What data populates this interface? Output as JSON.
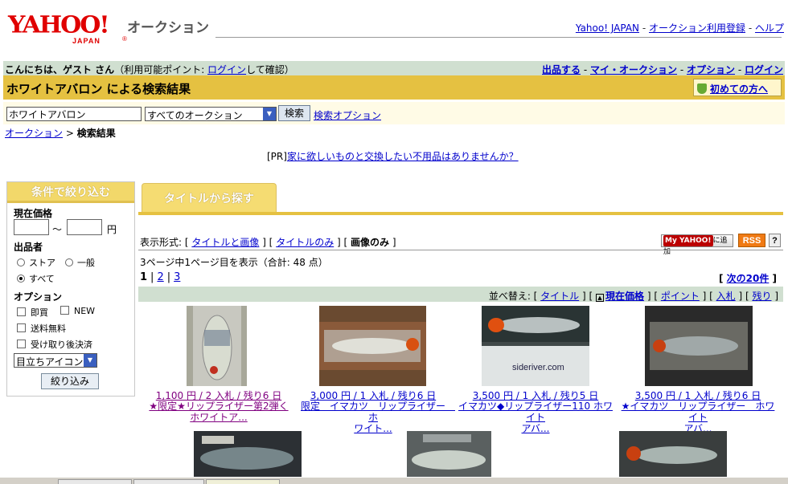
{
  "header": {
    "logo_text": "YAHOO!",
    "logo_sub": "JAPAN",
    "service": "オークション",
    "links": [
      "Yahoo! JAPAN",
      "オークション利用登録",
      "ヘルプ"
    ]
  },
  "greeting": {
    "hello": "こんにちは、ゲスト さん",
    "points_prefix": "（利用可能ポイント: ",
    "login": "ログイン",
    "points_suffix": "して確認）",
    "links": [
      "出品する",
      "マイ・オークション",
      "オプション",
      "ログイン"
    ]
  },
  "results": {
    "title": "ホワイトアバロン による検索結果",
    "first_time": "初めての方へ"
  },
  "search": {
    "query": "ホワイトアバロン",
    "category": "すべてのオークション",
    "button": "検索",
    "options_link": "検索オプション"
  },
  "breadcrumb": {
    "root": "オークション",
    "current": "検索結果"
  },
  "pr": {
    "prefix": "[PR]",
    "text": "家に欲しいものと交換したい不用品はありませんか？"
  },
  "filter": {
    "title": "条件で絞り込む",
    "price_label": "現在価格",
    "tilde": "～",
    "yen": "円",
    "seller_label": "出品者",
    "seller_options": [
      "ストア",
      "一般",
      "すべて"
    ],
    "option_label": "オプション",
    "options": [
      "即買",
      "NEW",
      "送料無料",
      "受け取り後決済"
    ],
    "icon_select": "目立ちアイコン",
    "button": "絞り込み"
  },
  "tab": {
    "label": "タイトルから探す"
  },
  "display": {
    "label": "表示形式:",
    "opt1": "タイトルと画像",
    "opt2": "タイトルのみ",
    "opt3": "画像のみ",
    "myyahoo": "に追加",
    "rss": "RSS",
    "help": "?"
  },
  "paging": {
    "summary": "3ページ中1ページ目を表示（合計: 48 点）",
    "pages": [
      "1",
      "2",
      "3"
    ],
    "next": "次の20件"
  },
  "sort": {
    "label": "並べ替え:",
    "options": [
      "タイトル",
      "現在価格",
      "ポイント",
      "入札",
      "残り"
    ]
  },
  "items": [
    {
      "price": "1,100 円 / 2 入札 / 残り6 日",
      "title1": "★限定★リップライザー第2弾く",
      "title2": "ホワイトア..."
    },
    {
      "price": "3,000 円 / 1 入札 / 残り6 日",
      "title1": "限定　イマカツ　リップライザー　ホ",
      "title2": "ワイト..."
    },
    {
      "price": "3,500 円 / 1 入札 / 残り5 日",
      "title1": "イマカツ◆リップライザー110 ホワイト",
      "title2": "アバ..."
    },
    {
      "price": "3,500 円 / 1 入札 / 残り6 日",
      "title1": "★イマカツ　リップライザー　ホワイト",
      "title2": "アバ..."
    }
  ],
  "thumb_text": {
    "sideriver": "sideriver.com"
  },
  "colors": {
    "accent_gold": "#e5c141",
    "bar_green": "#d0dfd0",
    "link": "#0000cc"
  }
}
